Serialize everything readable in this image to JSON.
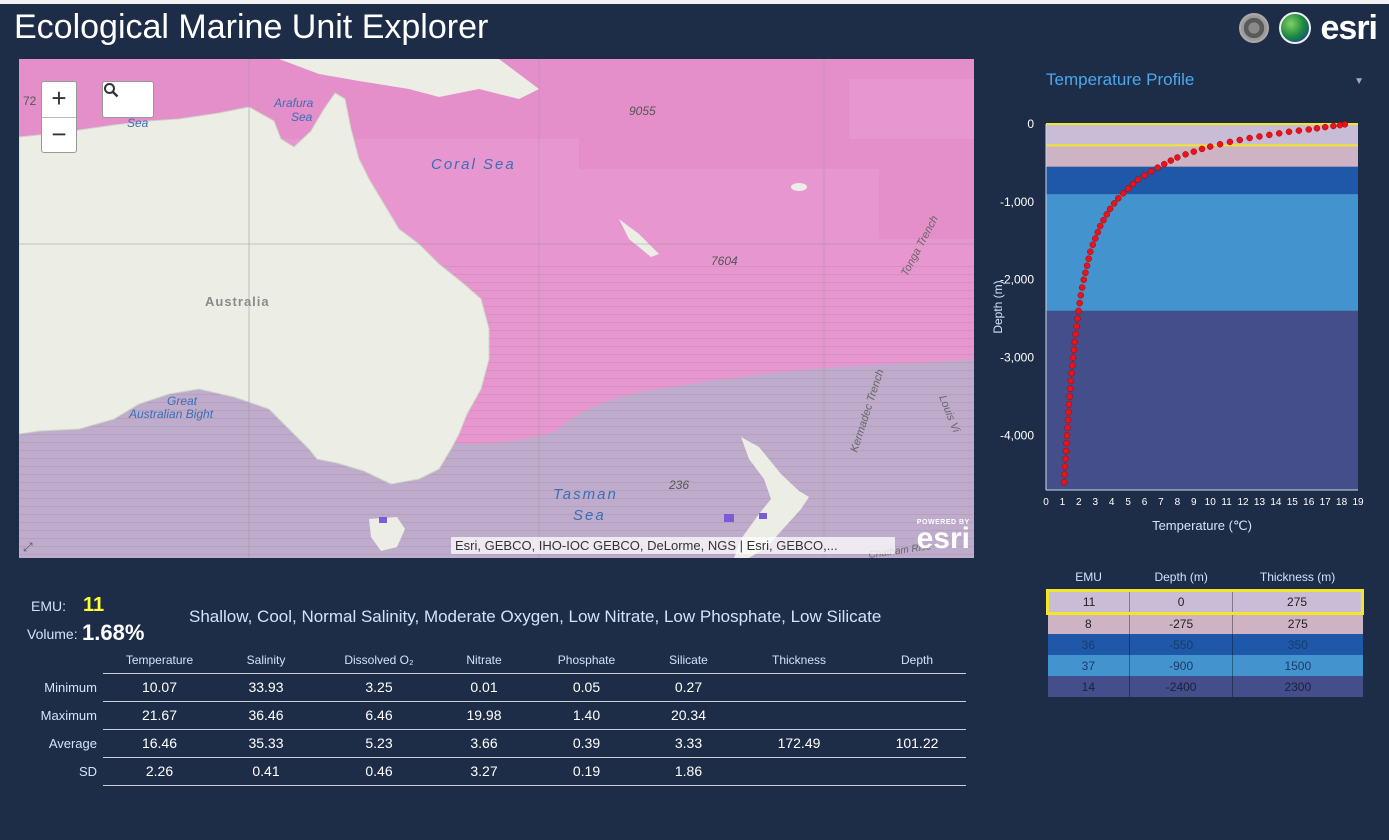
{
  "header": {
    "title": "Ecological Marine Unit Explorer",
    "brand": "esri"
  },
  "map": {
    "zoom_in": "+",
    "zoom_out": "−",
    "search_icon": "search-icon",
    "attribution": "Esri, GEBCO, IHO-IOC GEBCO, DeLorme, NGS | Esri, GEBCO,...",
    "powered_by": "POWERED BY",
    "powered_brand": "esri",
    "labels": {
      "australia": "Australia",
      "arafura_1": "Arafura",
      "arafura_2": "Sea",
      "coral": "Coral Sea",
      "tasman_1": "Tasman",
      "tasman_2": "Sea",
      "bight_1": "Great",
      "bight_2": "Australian Bight",
      "tonga": "Tonga Trench",
      "kermadec": "Kermadec Trench",
      "louisville": "Louis Vi",
      "depth_1": "9055",
      "depth_2": "7604",
      "depth_3": "236",
      "partial_1": "72",
      "partial_2": "Sea",
      "chatham": "Chatham Rise"
    },
    "colors": {
      "emu11": "#e896cf",
      "emu_south": "#bfaccc",
      "land": "#eceee6"
    }
  },
  "summary": {
    "emu_label": "EMU:",
    "emu_value": "11",
    "volume_label": "Volume:",
    "volume_value": "1.68%",
    "description": "Shallow, Cool, Normal Salinity, Moderate Oxygen, Low Nitrate, Low Phosphate, Low Silicate"
  },
  "stats": {
    "headers": [
      "Temperature",
      "Salinity",
      "Dissolved O₂",
      "Nitrate",
      "Phosphate",
      "Silicate",
      "Thickness",
      "Depth"
    ],
    "rows": [
      {
        "label": "Minimum",
        "values": [
          "10.07",
          "33.93",
          "3.25",
          "0.01",
          "0.05",
          "0.27",
          "",
          ""
        ]
      },
      {
        "label": "Maximum",
        "values": [
          "21.67",
          "36.46",
          "6.46",
          "19.98",
          "1.40",
          "20.34",
          "",
          ""
        ]
      },
      {
        "label": "Average",
        "values": [
          "16.46",
          "35.33",
          "5.23",
          "3.66",
          "0.39",
          "3.33",
          "172.49",
          "101.22"
        ]
      },
      {
        "label": "SD",
        "values": [
          "2.26",
          "0.41",
          "0.46",
          "3.27",
          "0.19",
          "1.86",
          "",
          ""
        ]
      }
    ]
  },
  "profile": {
    "selected": "Temperature Profile",
    "caret": "▼"
  },
  "chart_data": {
    "type": "scatter",
    "xlabel": "Temperature (℃)",
    "ylabel": "Depth (m)",
    "xlim": [
      0,
      19
    ],
    "ylim": [
      -4700,
      0
    ],
    "x_ticks": [
      "0",
      "1",
      "2",
      "3",
      "4",
      "5",
      "6",
      "7",
      "8",
      "9",
      "10",
      "11",
      "12",
      "13",
      "14",
      "15",
      "16",
      "17",
      "18",
      "19"
    ],
    "y_ticks": [
      {
        "value": 0,
        "label": "0"
      },
      {
        "value": -1000,
        "label": "-1,000"
      },
      {
        "value": -2000,
        "label": "-2,000"
      },
      {
        "value": -3000,
        "label": "-3,000"
      },
      {
        "value": -4000,
        "label": "-4,000"
      }
    ],
    "bands": [
      {
        "emu": "11",
        "top": 0,
        "bottom": -275,
        "color": "#c9bcd6"
      },
      {
        "emu": "8",
        "top": -275,
        "bottom": -550,
        "color": "#cdb3c3"
      },
      {
        "emu": "36",
        "top": -550,
        "bottom": -900,
        "color": "#1f58a8"
      },
      {
        "emu": "37",
        "top": -900,
        "bottom": -2400,
        "color": "#4393cf"
      },
      {
        "emu": "14",
        "top": -2400,
        "bottom": -4700,
        "color": "#434e8a"
      }
    ],
    "lines": [
      0,
      -275
    ],
    "series": [
      {
        "color": "#e8141c",
        "points": [
          [
            18.2,
            -5
          ],
          [
            17.9,
            -15
          ],
          [
            17.5,
            -25
          ],
          [
            17.0,
            -40
          ],
          [
            16.5,
            -55
          ],
          [
            16.0,
            -70
          ],
          [
            15.4,
            -85
          ],
          [
            14.8,
            -100
          ],
          [
            14.2,
            -120
          ],
          [
            13.6,
            -140
          ],
          [
            13.0,
            -160
          ],
          [
            12.4,
            -180
          ],
          [
            11.8,
            -205
          ],
          [
            11.2,
            -230
          ],
          [
            10.6,
            -260
          ],
          [
            10.0,
            -290
          ],
          [
            9.5,
            -320
          ],
          [
            9.0,
            -355
          ],
          [
            8.5,
            -390
          ],
          [
            8.0,
            -430
          ],
          [
            7.6,
            -470
          ],
          [
            7.2,
            -515
          ],
          [
            6.8,
            -560
          ],
          [
            6.4,
            -610
          ],
          [
            6.0,
            -660
          ],
          [
            5.6,
            -715
          ],
          [
            5.3,
            -770
          ],
          [
            5.0,
            -830
          ],
          [
            4.7,
            -890
          ],
          [
            4.4,
            -955
          ],
          [
            4.15,
            -1020
          ],
          [
            3.9,
            -1090
          ],
          [
            3.7,
            -1160
          ],
          [
            3.5,
            -1235
          ],
          [
            3.3,
            -1310
          ],
          [
            3.15,
            -1390
          ],
          [
            3.0,
            -1470
          ],
          [
            2.85,
            -1550
          ],
          [
            2.7,
            -1640
          ],
          [
            2.6,
            -1730
          ],
          [
            2.5,
            -1820
          ],
          [
            2.4,
            -1910
          ],
          [
            2.3,
            -2000
          ],
          [
            2.2,
            -2100
          ],
          [
            2.12,
            -2200
          ],
          [
            2.05,
            -2300
          ],
          [
            1.98,
            -2400
          ],
          [
            1.92,
            -2500
          ],
          [
            1.86,
            -2600
          ],
          [
            1.8,
            -2700
          ],
          [
            1.75,
            -2800
          ],
          [
            1.7,
            -2900
          ],
          [
            1.65,
            -3000
          ],
          [
            1.6,
            -3100
          ],
          [
            1.56,
            -3200
          ],
          [
            1.52,
            -3300
          ],
          [
            1.48,
            -3400
          ],
          [
            1.44,
            -3500
          ],
          [
            1.4,
            -3600
          ],
          [
            1.37,
            -3700
          ],
          [
            1.34,
            -3800
          ],
          [
            1.31,
            -3900
          ],
          [
            1.28,
            -4000
          ],
          [
            1.25,
            -4100
          ],
          [
            1.22,
            -4200
          ],
          [
            1.19,
            -4300
          ],
          [
            1.16,
            -4400
          ],
          [
            1.13,
            -4500
          ],
          [
            1.1,
            -4600
          ]
        ]
      }
    ]
  },
  "emu_table": {
    "headers": [
      "EMU",
      "Depth (m)",
      "Thickness (m)"
    ],
    "rows": [
      {
        "emu": "11",
        "depth": "0",
        "thickness": "275",
        "color": "#c9bcd6",
        "text": "#222"
      },
      {
        "emu": "8",
        "depth": "-275",
        "thickness": "275",
        "color": "#cdb3c3",
        "text": "#222"
      },
      {
        "emu": "36",
        "depth": "-550",
        "thickness": "350",
        "color": "#1f58a8",
        "text": "#1a3a6a"
      },
      {
        "emu": "37",
        "depth": "-900",
        "thickness": "1500",
        "color": "#4393cf",
        "text": "#1a3a6a"
      },
      {
        "emu": "14",
        "depth": "-2400",
        "thickness": "2300",
        "color": "#434e8a",
        "text": "#1a2040"
      }
    ]
  }
}
